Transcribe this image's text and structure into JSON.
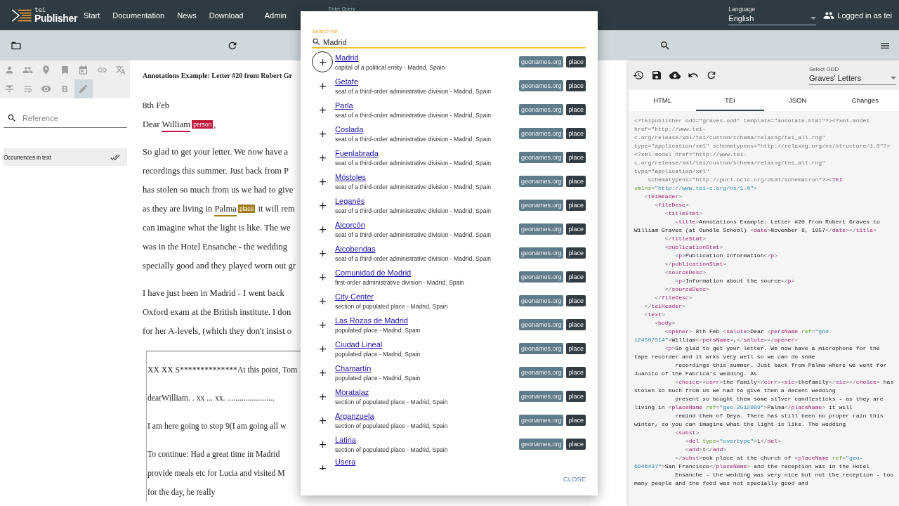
{
  "header": {
    "logo": {
      "small": "tei",
      "name": "Publisher"
    },
    "nav": [
      "Start",
      "Documentation",
      "News",
      "Download",
      "Admin"
    ],
    "query": {
      "label": "Enter Query"
    },
    "language": {
      "label": "Language",
      "value": "English"
    },
    "user": "Logged in as tei"
  },
  "annotation_tools": [
    {
      "kind": "person",
      "selected": false
    },
    {
      "kind": "people",
      "selected": false
    },
    {
      "kind": "pin",
      "selected": false
    },
    {
      "kind": "bookmark",
      "selected": false
    },
    {
      "kind": "calendar",
      "selected": false
    },
    {
      "kind": "link",
      "selected": false
    },
    {
      "kind": "translate",
      "selected": false
    },
    {
      "kind": "strike",
      "selected": false
    },
    {
      "kind": "wrap",
      "selected": false
    },
    {
      "kind": "eye",
      "selected": false
    },
    {
      "kind": "bold",
      "label": "B",
      "selected": false
    },
    {
      "kind": "pen",
      "selected": true
    }
  ],
  "reference_search": {
    "placeholder": "Reference"
  },
  "occurrences": {
    "label": "Occurrences in text"
  },
  "document": {
    "title": "Annotations Example: Letter #20 from Robert Gr",
    "blocks": [
      {
        "kind": "plain",
        "paras": [
          [
            [
              {
                "text": "8th Feb"
              }
            ],
            [
              {
                "text": "Dear "
              },
              {
                "text": "William",
                "tag": "person",
                "color": "#c3183c"
              },
              {
                "text": ","
              }
            ]
          ],
          [
            [
              {
                "text": "So glad to get your letter. We now have a"
              }
            ],
            [
              {
                "text": "recordings this summer. Just back from P"
              }
            ],
            [
              {
                "text": "has stolen so much from us we had to give"
              }
            ],
            [
              {
                "text": "as they are living in "
              },
              {
                "text": "Palma",
                "tag": "place",
                "color": "#a27d1e"
              },
              {
                "text": " it will rem"
              }
            ],
            [
              {
                "text": "can imagine what the light is like. The we"
              }
            ],
            [
              {
                "text": "was in the Hotel Ensanche - the wedding"
              }
            ],
            [
              {
                "text": "specially good and they played worn out gr"
              }
            ]
          ],
          [
            [
              {
                "text": "I have just been in Madrid - I went back"
              }
            ],
            [
              {
                "text": "Oxford exam at the British institute. I don"
              }
            ],
            [
              {
                "text": "for her A-levels, (which they don't insist o"
              }
            ]
          ]
        ]
      },
      {
        "kind": "boxed",
        "paras": [
          [
            [
              {
                "text": "XX XX S**************At this point, Tom"
              }
            ]
          ],
          [
            [
              {
                "text": "dearWilliam. . xx ... xx. ......................."
              }
            ]
          ],
          [
            [
              {
                "text": "I am here going to stop 9(I am going all w"
              }
            ]
          ],
          [
            [
              {
                "text": "To continue: Had a great time in Madrid"
              }
            ],
            [
              {
                "text": "provide meals etc for Lucia and visited M"
              }
            ],
            [
              {
                "text": "for the day, he really"
              }
            ]
          ]
        ]
      }
    ]
  },
  "dialog": {
    "search": {
      "label": "Search for",
      "value": "Madrid"
    },
    "results": [
      {
        "name": "Madrid",
        "description": "capital of a political entity - Madrid, Spain",
        "focused": true,
        "tags": [
          {
            "text": "geonames.org",
            "kind": "source"
          },
          {
            "text": "place",
            "kind": "type"
          }
        ]
      },
      {
        "name": "Getafe",
        "description": "seat of a third-order administrative division - Madrid, Spain",
        "focused": false,
        "tags": [
          {
            "text": "geonames.org",
            "kind": "source"
          },
          {
            "text": "place",
            "kind": "type"
          }
        ]
      },
      {
        "name": "Parla",
        "description": "seat of a third-order administrative division - Madrid, Spain",
        "focused": false,
        "tags": [
          {
            "text": "geonames.org",
            "kind": "source"
          },
          {
            "text": "place",
            "kind": "type"
          }
        ]
      },
      {
        "name": "Coslada",
        "description": "seat of a third-order administrative division - Madrid, Spain",
        "focused": false,
        "tags": [
          {
            "text": "geonames.org",
            "kind": "source"
          },
          {
            "text": "place",
            "kind": "type"
          }
        ]
      },
      {
        "name": "Fuenlabrada",
        "description": "seat of a third-order administrative division - Madrid, Spain",
        "focused": false,
        "tags": [
          {
            "text": "geonames.org",
            "kind": "source"
          },
          {
            "text": "place",
            "kind": "type"
          }
        ]
      },
      {
        "name": "Móstoles",
        "description": "seat of a third-order administrative division - Madrid, Spain",
        "focused": false,
        "tags": [
          {
            "text": "geonames.org",
            "kind": "source"
          },
          {
            "text": "place",
            "kind": "type"
          }
        ]
      },
      {
        "name": "Leganés",
        "description": "seat of a third-order administrative division - Madrid, Spain",
        "focused": false,
        "tags": [
          {
            "text": "geonames.org",
            "kind": "source"
          },
          {
            "text": "place",
            "kind": "type"
          }
        ]
      },
      {
        "name": "Alcorcón",
        "description": "seat of a third-order administrative division - Madrid, Spain",
        "focused": false,
        "tags": [
          {
            "text": "geonames.org",
            "kind": "source"
          },
          {
            "text": "place",
            "kind": "type"
          }
        ]
      },
      {
        "name": "Alcobendas",
        "description": "seat of a third-order administrative division - Madrid, Spain",
        "focused": false,
        "tags": [
          {
            "text": "geonames.org",
            "kind": "source"
          },
          {
            "text": "place",
            "kind": "type"
          }
        ]
      },
      {
        "name": "Comunidad de Madrid",
        "description": "first-order administrative division - Madrid, Spain",
        "focused": false,
        "tags": [
          {
            "text": "geonames.org",
            "kind": "source"
          },
          {
            "text": "place",
            "kind": "type"
          }
        ]
      },
      {
        "name": "City Center",
        "description": "section of populated place - Madrid, Spain",
        "focused": false,
        "tags": [
          {
            "text": "geonames.org",
            "kind": "source"
          },
          {
            "text": "place",
            "kind": "type"
          }
        ]
      },
      {
        "name": "Las Rozas de Madrid",
        "description": "populated place - Madrid, Spain",
        "focused": false,
        "tags": [
          {
            "text": "geonames.org",
            "kind": "source"
          },
          {
            "text": "place",
            "kind": "type"
          }
        ]
      },
      {
        "name": "Ciudad Lineal",
        "description": "populated place - Madrid, Spain",
        "focused": false,
        "tags": [
          {
            "text": "geonames.org",
            "kind": "source"
          },
          {
            "text": "place",
            "kind": "type"
          }
        ]
      },
      {
        "name": "Chamartín",
        "description": "populated place - Madrid, Spain",
        "focused": false,
        "tags": [
          {
            "text": "geonames.org",
            "kind": "source"
          },
          {
            "text": "place",
            "kind": "type"
          }
        ]
      },
      {
        "name": "Moratalaz",
        "description": "section of populated place - Madrid, Spain",
        "focused": false,
        "tags": [
          {
            "text": "geonames.org",
            "kind": "source"
          },
          {
            "text": "place",
            "kind": "type"
          }
        ]
      },
      {
        "name": "Arganzuela",
        "description": "section of populated place - Madrid, Spain",
        "focused": false,
        "tags": [
          {
            "text": "geonames.org",
            "kind": "source"
          },
          {
            "text": "place",
            "kind": "type"
          }
        ]
      },
      {
        "name": "Latina",
        "description": "section of populated place - Madrid, Spain",
        "focused": false,
        "tags": [
          {
            "text": "geonames.org",
            "kind": "source"
          },
          {
            "text": "place",
            "kind": "type"
          }
        ]
      },
      {
        "name": "Usera",
        "focused": false
      }
    ],
    "close": "CLOSE"
  },
  "editor": {
    "odd": {
      "label": "Select ODD",
      "value": "Graves' Letters"
    },
    "tabs": [
      {
        "label": "HTML",
        "selected": false
      },
      {
        "label": "TEI",
        "selected": true
      },
      {
        "label": "JSON",
        "selected": false
      },
      {
        "label": "Changes",
        "selected": false
      }
    ],
    "code": [
      "<?teipublisher odd=\"graves.odd\" template=\"annotate.html\"?><?xml-model",
      "href=\"http://www.tei-",
      "c.org/release/xml/tei/custom/schema/relaxng/tei_all.rng\"",
      "type=\"application/xml\" schematypens=\"http://relaxng.org/ns/structure/1.0\"?>",
      "<?xml-model href=\"http://www.tei-",
      "c.org/release/xml/tei/custom/schema/relaxng/tei_all.rng\"",
      "type=\"application/xml\"",
      "    schematypens=\"http://purl.oclc.org/dsdl/schematron\"?><TEI",
      "xmlns=\"http://www.tei-c.org/ns/1.0\">",
      "   <teiHeader>",
      "      <fileDesc>",
      "         <titleStmt>",
      "            <title>Annotations Example: Letter #20 from Robert Graves to",
      "William Graves (at Oundle School) <date>November 8, 1957</date></title>",
      "         </titleStmt>",
      "         <publicationStmt>",
      "            <p>Publication Information</p>",
      "         </publicationStmt>",
      "         <sourceDesc>",
      "            <p>Information about the source</p>",
      "         </sourceDesc>",
      "      </fileDesc>",
      "   </teiHeader>",
      "   <text>",
      "      <body>",
      "         <opener> 8th Feb <salute>Dear <persName ref=\"gnd-",
      "124507514\">William</persName>,</salute></opener>",
      "         <p>So glad to get your letter. We now have a microphone for the",
      "tape recorder and it wrks very well so we can do some",
      "            recordings this summer. Just back from Palma where we went for",
      "Juanito of the Fabrica's wedding. As",
      "            <choice><corr>the family</corr><sic>thefamily</sic></choice> has",
      "stolen so much from us we had to give them a decent wedding",
      "            present so bought them some silver candlesticks - as they are",
      "living in <placeName ref=\"geo-2512989\">Palma</placeName> it will",
      "            remind them of Deya. There has still been no proper rain this",
      "winter, so you can imagine what the light is like. The wedding",
      "            <subst>",
      "               <del type=\"overtype\">L</del>",
      "               <add>t</add>",
      "            </subst>ook place at the church of <placeName ref=\"geo-",
      "6946437\">San Francisco</placeName> and the reception was in the Hotel",
      "            Ensanche - the wedding was very nice but not the reception - too",
      "many people and the food was not specially good and"
    ]
  }
}
